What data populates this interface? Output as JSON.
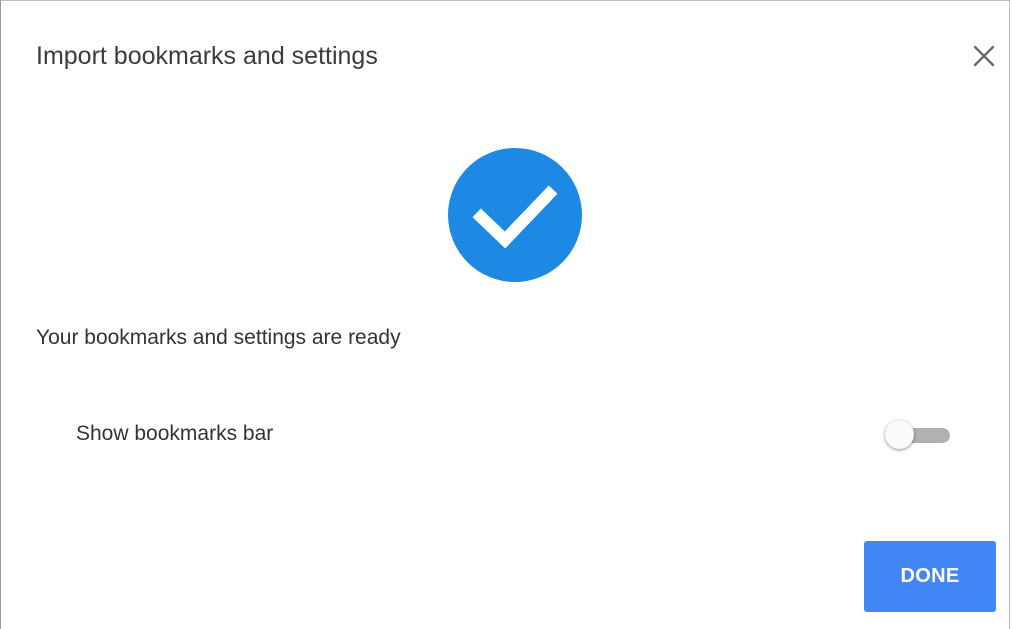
{
  "dialog": {
    "title": "Import bookmarks and settings",
    "close_icon": "close-icon",
    "status_icon": "checkmark-circle-icon",
    "message": "Your bookmarks and settings are ready",
    "show_bookmarks_bar": {
      "label": "Show bookmarks bar",
      "enabled": false
    },
    "done_label": "DONE"
  },
  "colors": {
    "accent": "#1e88e5",
    "button": "#4285f4",
    "toggle_track": "#b0b0b0",
    "text": "#333333"
  }
}
